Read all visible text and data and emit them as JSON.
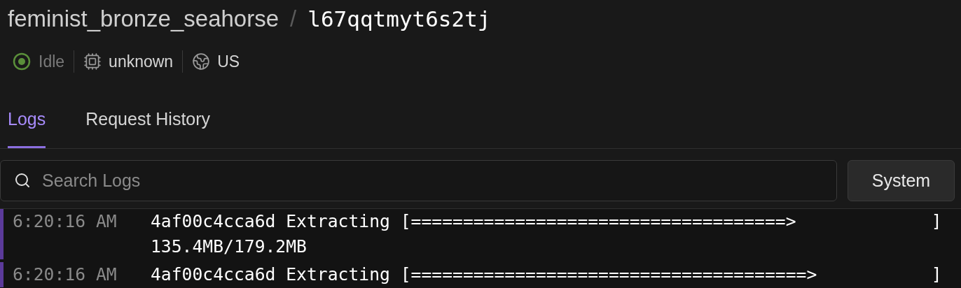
{
  "breadcrumb": {
    "project": "feminist_bronze_seahorse",
    "separator": "/",
    "id": "l67qqtmyt6s2tj"
  },
  "status": [
    {
      "kind": "state",
      "label": "Idle"
    },
    {
      "kind": "cpu",
      "label": "unknown"
    },
    {
      "kind": "region",
      "label": "US"
    }
  ],
  "tabs": [
    {
      "label": "Logs",
      "selected": true
    },
    {
      "label": "Request History",
      "selected": false
    }
  ],
  "search": {
    "placeholder": "Search Logs"
  },
  "filter_button": "System",
  "logs": [
    {
      "time": "6:20:16 AM",
      "message": "4af00c4cca6d Extracting [====================================>             ] 135.4MB/179.2MB"
    },
    {
      "time": "6:20:16 AM",
      "message": "4af00c4cca6d Extracting [======================================>           ]"
    }
  ]
}
